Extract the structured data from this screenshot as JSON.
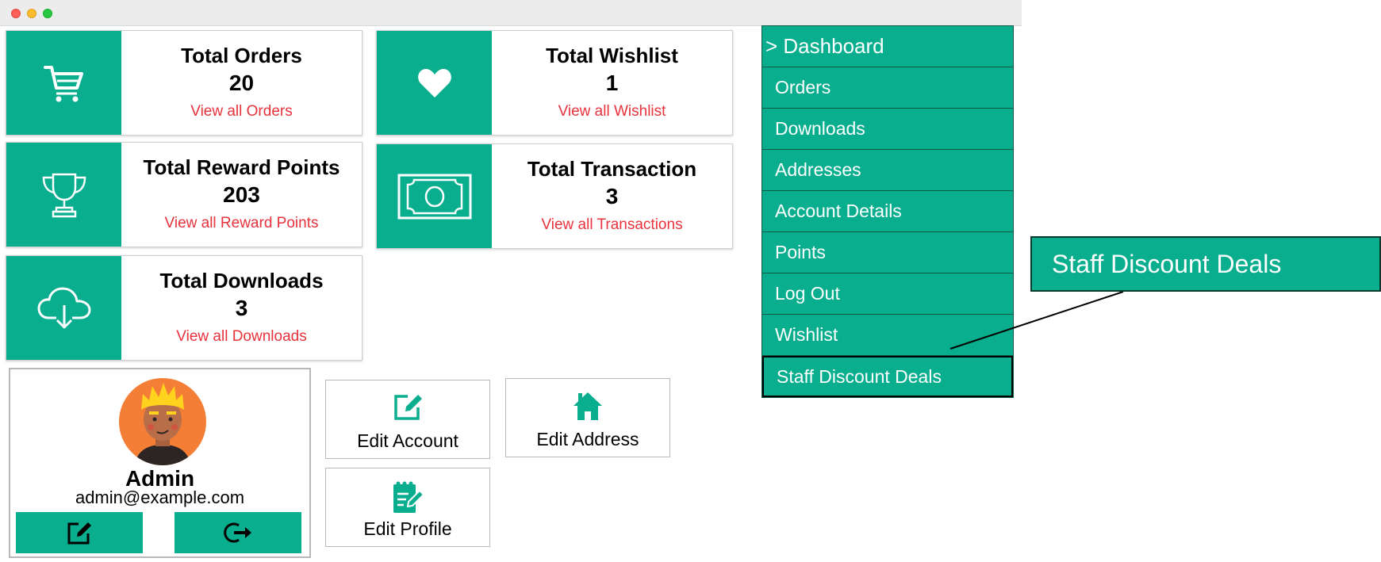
{
  "cards": [
    {
      "title": "Total Orders",
      "value": "20",
      "link": "View all Orders",
      "icon": "cart-icon"
    },
    {
      "title": "Total Wishlist",
      "value": "1",
      "link": "View all Wishlist",
      "icon": "heart-icon"
    },
    {
      "title": "Total Reward Points",
      "value": "203",
      "link": "View all Reward Points",
      "icon": "trophy-icon"
    },
    {
      "title": "Total Transaction",
      "value": "3",
      "link": "View all Transactions",
      "icon": "banknote-icon"
    },
    {
      "title": "Total Downloads",
      "value": "3",
      "link": "View all Downloads",
      "icon": "cloud-download-icon"
    }
  ],
  "profile": {
    "name": "Admin",
    "email": "admin@example.com",
    "edit_icon": "edit-icon",
    "logout_icon": "logout-icon"
  },
  "actions": {
    "edit_account": "Edit Account",
    "edit_address": "Edit Address",
    "edit_profile": "Edit Profile"
  },
  "menu": [
    {
      "label": "> Dashboard",
      "active": true
    },
    {
      "label": "Orders"
    },
    {
      "label": "Downloads"
    },
    {
      "label": "Addresses"
    },
    {
      "label": "Account Details"
    },
    {
      "label": "Points"
    },
    {
      "label": "Log Out"
    },
    {
      "label": "Wishlist"
    },
    {
      "label": "Staff Discount Deals",
      "highlighted": true
    }
  ],
  "callout": {
    "label": "Staff Discount Deals"
  },
  "colors": {
    "accent": "#08ae8e",
    "link": "#e8323c",
    "menu_border": "#0b5a48"
  }
}
